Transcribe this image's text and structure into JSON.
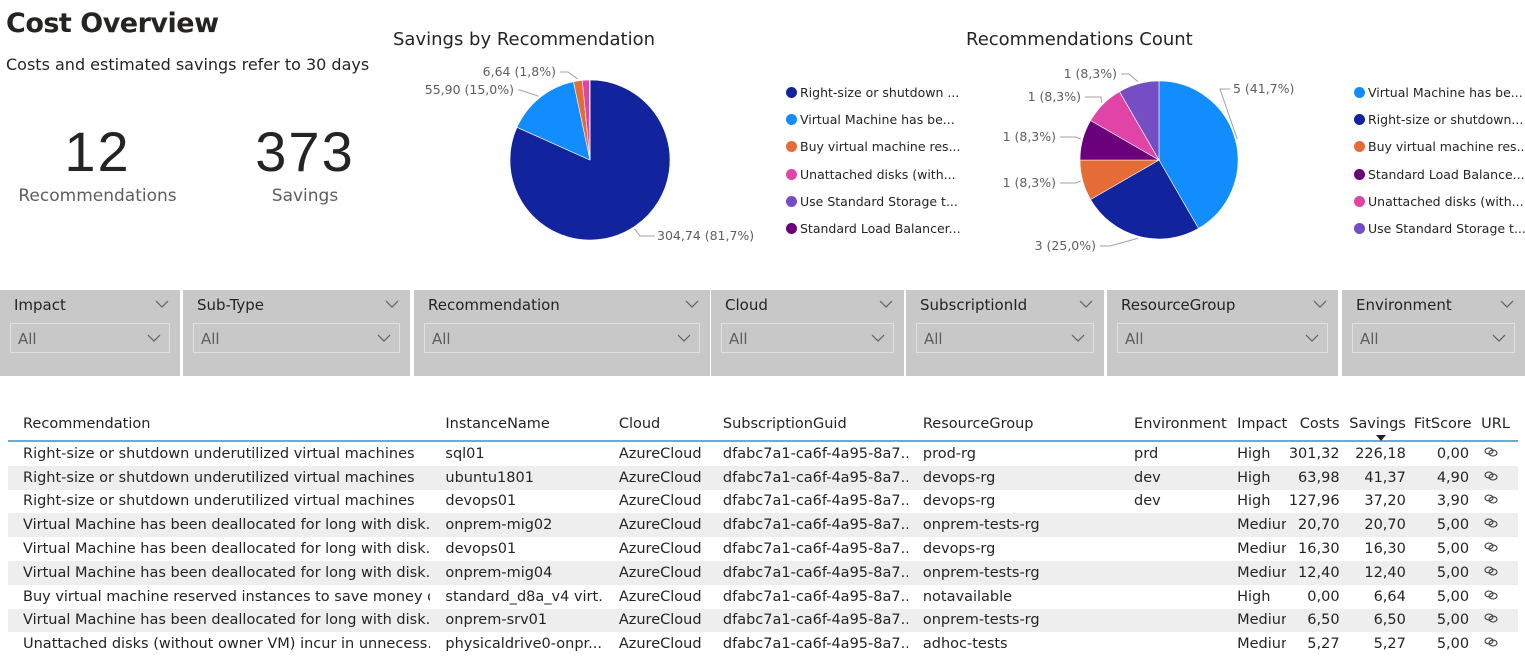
{
  "header": {
    "title": "Cost Overview",
    "subtitle": "Costs and estimated savings refer to 30 days"
  },
  "kpis": [
    {
      "value": "12",
      "label": "Recommendations"
    },
    {
      "value": "373",
      "label": "Savings"
    }
  ],
  "colors": {
    "right_size": "#12239e",
    "vm_dealloc": "#118dff",
    "buy_reserved": "#e66c37",
    "unattached": "#e044a7",
    "std_storage": "#744ec2",
    "std_lb": "#6b007b"
  },
  "chart_data": [
    {
      "type": "pie",
      "title": "Savings by Recommendation",
      "legend_position": "right",
      "slices": [
        {
          "name": "Right-size or shutdown underutilized virtual machines",
          "legend": "Right-size or shutdown ...",
          "value": 304.74,
          "label": "304,74 (81,7%)",
          "color": "#12239e"
        },
        {
          "name": "Virtual Machine has been deallocated for long with disks",
          "legend": "Virtual Machine has be...",
          "value": 55.9,
          "label": "55,90 (15,0%)",
          "color": "#118dff"
        },
        {
          "name": "Buy virtual machine reserved instances",
          "legend": "Buy virtual machine res...",
          "value": 6.64,
          "label": "6,64 (1,8%)",
          "color": "#e66c37"
        },
        {
          "name": "Unattached disks (without owner VM)",
          "legend": "Unattached disks (with...",
          "value": 5.27,
          "label": "",
          "color": "#e044a7"
        },
        {
          "name": "Use Standard Storage",
          "legend": "Use Standard Storage t...",
          "value": 0.4,
          "label": "",
          "color": "#744ec2"
        },
        {
          "name": "Standard Load Balancer",
          "legend": "Standard Load Balancer...",
          "value": 0.05,
          "label": "",
          "color": "#6b007b"
        }
      ]
    },
    {
      "type": "pie",
      "title": "Recommendations Count",
      "legend_position": "right",
      "slices": [
        {
          "name": "Virtual Machine has been deallocated for long with disks",
          "legend": "Virtual Machine has be...",
          "value": 5,
          "label": "5 (41,7%)",
          "color": "#118dff"
        },
        {
          "name": "Right-size or shutdown underutilized virtual machines",
          "legend": "Right-size or shutdown...",
          "value": 3,
          "label": "3 (25,0%)",
          "color": "#12239e"
        },
        {
          "name": "Buy virtual machine reserved instances",
          "legend": "Buy virtual machine res...",
          "value": 1,
          "label": "1 (8,3%)",
          "color": "#e66c37"
        },
        {
          "name": "Standard Load Balancer",
          "legend": "Standard Load Balance...",
          "value": 1,
          "label": "1 (8,3%)",
          "color": "#6b007b"
        },
        {
          "name": "Unattached disks (without owner VM)",
          "legend": "Unattached disks (with...",
          "value": 1,
          "label": "1 (8,3%)",
          "color": "#e044a7"
        },
        {
          "name": "Use Standard Storage",
          "legend": "Use Standard Storage t...",
          "value": 1,
          "label": "1 (8,3%)",
          "color": "#744ec2"
        }
      ]
    }
  ],
  "slicers": [
    {
      "title": "Impact",
      "value": "All"
    },
    {
      "title": "Sub-Type",
      "value": "All"
    },
    {
      "title": "Recommendation",
      "value": "All"
    },
    {
      "title": "Cloud",
      "value": "All"
    },
    {
      "title": "SubscriptionId",
      "value": "All"
    },
    {
      "title": "ResourceGroup",
      "value": "All"
    },
    {
      "title": "Environment",
      "value": "All"
    }
  ],
  "table": {
    "columns": [
      "Recommendation",
      "InstanceName",
      "Cloud",
      "SubscriptionGuid",
      "ResourceGroup",
      "Environment",
      "Impact",
      "Costs",
      "Savings",
      "FitScore",
      "URL"
    ],
    "sorted_column": "Savings",
    "rows": [
      [
        "Right-size or shutdown underutilized virtual machines",
        "sql01",
        "AzureCloud",
        "dfabc7a1-ca6f-4a95-8a7...",
        "prod-rg",
        "prd",
        "High",
        "301,32",
        "226,18",
        "0,00",
        "link-icon"
      ],
      [
        "Right-size or shutdown underutilized virtual machines",
        "ubuntu1801",
        "AzureCloud",
        "dfabc7a1-ca6f-4a95-8a7...",
        "devops-rg",
        "dev",
        "High",
        "63,98",
        "41,37",
        "4,90",
        "link-icon"
      ],
      [
        "Right-size or shutdown underutilized virtual machines",
        "devops01",
        "AzureCloud",
        "dfabc7a1-ca6f-4a95-8a7...",
        "devops-rg",
        "dev",
        "High",
        "127,96",
        "37,20",
        "3,90",
        "link-icon"
      ],
      [
        "Virtual Machine has been deallocated for long with disk...",
        "onprem-mig02",
        "AzureCloud",
        "dfabc7a1-ca6f-4a95-8a7...",
        "onprem-tests-rg",
        "",
        "Medium",
        "20,70",
        "20,70",
        "5,00",
        "link-icon"
      ],
      [
        "Virtual Machine has been deallocated for long with disk...",
        "devops01",
        "AzureCloud",
        "dfabc7a1-ca6f-4a95-8a7...",
        "devops-rg",
        "",
        "Medium",
        "16,30",
        "16,30",
        "5,00",
        "link-icon"
      ],
      [
        "Virtual Machine has been deallocated for long with disk...",
        "onprem-mig04",
        "AzureCloud",
        "dfabc7a1-ca6f-4a95-8a7...",
        "onprem-tests-rg",
        "",
        "Medium",
        "12,40",
        "12,40",
        "5,00",
        "link-icon"
      ],
      [
        "Buy virtual machine reserved instances to save money o...",
        "standard_d8a_v4 virt...",
        "AzureCloud",
        "dfabc7a1-ca6f-4a95-8a7...",
        "notavailable",
        "",
        "High",
        "0,00",
        "6,64",
        "5,00",
        "link-icon"
      ],
      [
        "Virtual Machine has been deallocated for long with disk...",
        "onprem-srv01",
        "AzureCloud",
        "dfabc7a1-ca6f-4a95-8a7...",
        "onprem-tests-rg",
        "",
        "Medium",
        "6,50",
        "6,50",
        "5,00",
        "link-icon"
      ],
      [
        "Unattached disks (without owner VM) incur in unnecess...",
        "physicaldrive0-onpr...",
        "AzureCloud",
        "dfabc7a1-ca6f-4a95-8a7...",
        "adhoc-tests",
        "",
        "Medium",
        "5,27",
        "5,27",
        "5,00",
        "link-icon"
      ]
    ]
  }
}
